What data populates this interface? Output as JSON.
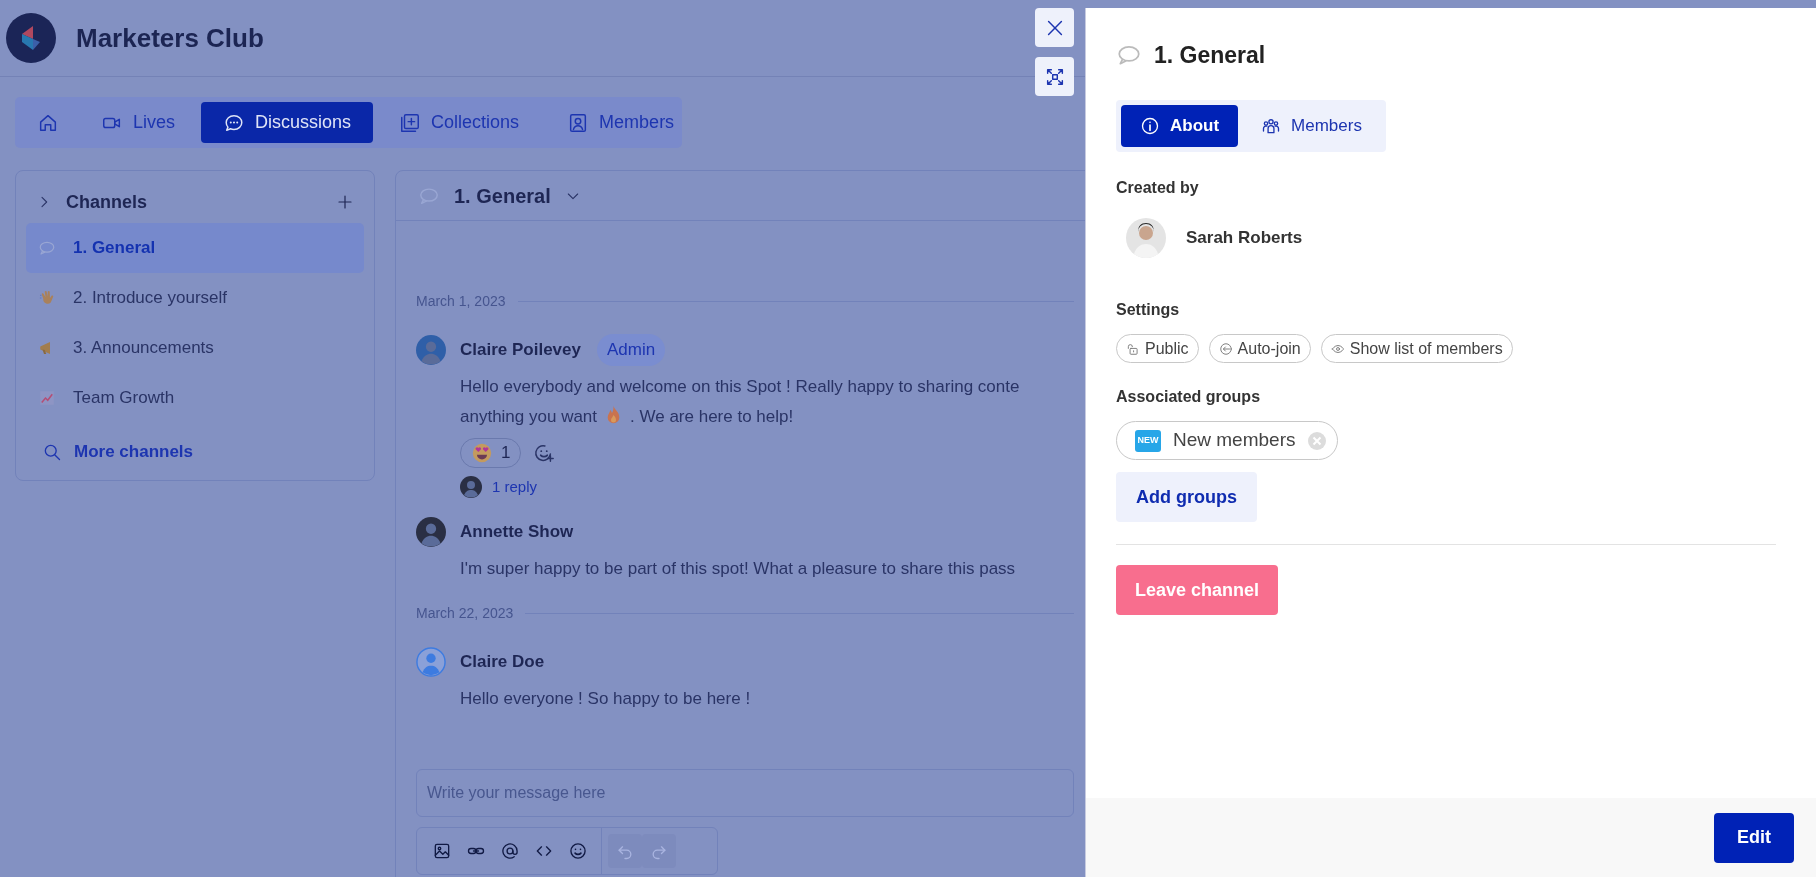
{
  "app": {
    "title": "Marketers Club"
  },
  "nav_tabs": [
    {
      "selected": false
    },
    {
      "label": "Lives",
      "selected": false
    },
    {
      "label": "Discussions",
      "selected": true
    },
    {
      "label": "Collections",
      "selected": false
    },
    {
      "label": "Members",
      "selected": false
    }
  ],
  "sidebar": {
    "title": "Channels",
    "items": [
      {
        "label": "1. General",
        "selected": true
      },
      {
        "label": "2. Introduce yourself",
        "selected": false
      },
      {
        "label": "3. Announcements",
        "selected": false
      },
      {
        "label": "Team Growth",
        "selected": false
      }
    ],
    "more": "More channels"
  },
  "chat": {
    "title": "1. General",
    "feed": [
      {
        "kind": "date",
        "text": "March 1, 2023"
      },
      {
        "kind": "message",
        "author": "Claire Poilevey",
        "avatar": {
          "kind": "photo"
        },
        "badge": "Admin",
        "lines": [
          [
            {
              "kind": "text",
              "text": "Hello everybody and welcome on this Spot ! Really happy to sharing conte"
            }
          ],
          [
            {
              "kind": "text",
              "text": "anything you want"
            },
            {
              "kind": "emoji"
            },
            {
              "kind": "text",
              "text": ". We are here to help!"
            }
          ]
        ],
        "reactions": [
          {
            "count": "1"
          }
        ],
        "replies": "1 reply"
      },
      {
        "kind": "message",
        "author": "Annette Show",
        "avatar": {
          "kind": "photo"
        },
        "lines": [
          [
            {
              "kind": "text",
              "text": "I'm super happy to be part of this spot! What a pleasure to share this pass"
            }
          ]
        ]
      },
      {
        "kind": "date",
        "text": "March 22, 2023"
      },
      {
        "kind": "message",
        "author": "Claire Doe",
        "avatar": {
          "kind": "generic"
        },
        "lines": [
          [
            {
              "kind": "text",
              "text": "Hello everyone ! So happy to be here !"
            }
          ]
        ]
      }
    ],
    "composer": {
      "placeholder": "Write your message here",
      "tools": [
        {
          "disabled": false
        },
        {
          "disabled": false
        },
        {
          "disabled": false
        },
        {
          "disabled": false
        },
        {
          "disabled": false
        },
        {
          "disabled": true
        },
        {
          "disabled": true
        }
      ]
    }
  },
  "panel": {
    "title": "1. General",
    "tabs": [
      {
        "label": "About",
        "selected": true
      },
      {
        "label": "Members",
        "selected": false
      }
    ],
    "created_by_label": "Created by",
    "creator": "Sarah Roberts",
    "settings_label": "Settings",
    "settings": [
      {
        "label": "Public"
      },
      {
        "label": "Auto-join"
      },
      {
        "label": "Show list of members"
      }
    ],
    "groups_label": "Associated groups",
    "groups": [
      {
        "label": "New members",
        "badge": "NEW",
        "removable": true
      }
    ],
    "add_groups": "Add groups",
    "leave": "Leave channel",
    "edit": "Edit"
  }
}
